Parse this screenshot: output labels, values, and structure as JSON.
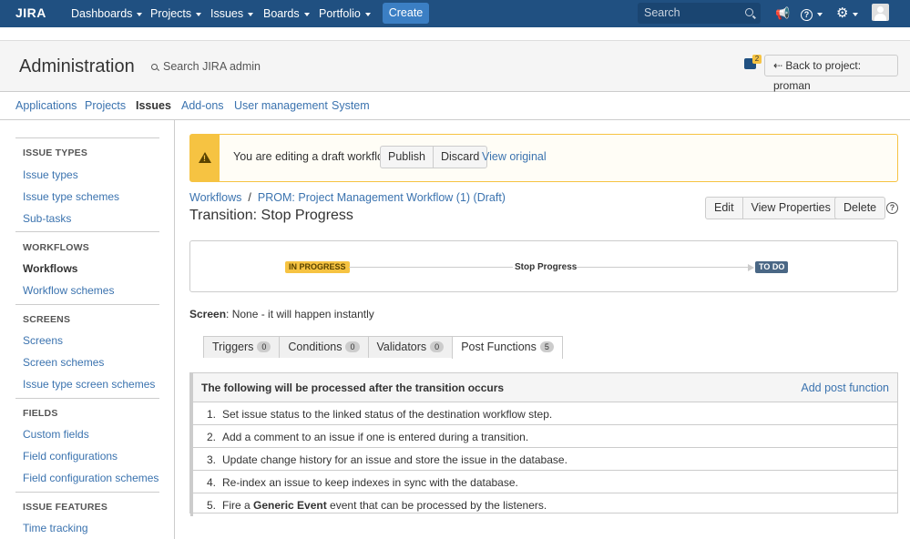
{
  "topnav": {
    "logo": "JIRA",
    "items": [
      "Dashboards",
      "Projects",
      "Issues",
      "Boards",
      "Portfolio"
    ],
    "create": "Create",
    "search_placeholder": "Search"
  },
  "header": {
    "title": "Administration",
    "search": "Search JIRA admin",
    "notif_count": "2",
    "back": "Back to project: proman"
  },
  "admin_tabs": [
    "Applications",
    "Projects",
    "Issues",
    "Add-ons",
    "User management",
    "System"
  ],
  "sidebar": {
    "sections": [
      {
        "heading": "ISSUE TYPES",
        "items": [
          "Issue types",
          "Issue type schemes",
          "Sub-tasks"
        ]
      },
      {
        "heading": "WORKFLOWS",
        "items": [
          "Workflows",
          "Workflow schemes"
        ]
      },
      {
        "heading": "SCREENS",
        "items": [
          "Screens",
          "Screen schemes",
          "Issue type screen schemes"
        ]
      },
      {
        "heading": "FIELDS",
        "items": [
          "Custom fields",
          "Field configurations",
          "Field configuration schemes"
        ]
      },
      {
        "heading": "ISSUE FEATURES",
        "items": [
          "Time tracking"
        ]
      }
    ]
  },
  "warning": {
    "text": "You are editing a draft workflow.",
    "publish": "Publish",
    "discard": "Discard",
    "view_original": "View original"
  },
  "breadcrumb": {
    "root": "Workflows",
    "sep": "/",
    "current": "PROM: Project Management Workflow (1) (Draft)"
  },
  "page_title": "Transition: Stop Progress",
  "toolbar": {
    "edit": "Edit",
    "view_properties": "View Properties",
    "delete": "Delete",
    "help": "?"
  },
  "diagram": {
    "from": "IN PROGRESS",
    "transition": "Stop Progress",
    "to": "TO DO"
  },
  "screen": {
    "label": "Screen",
    "value": ": None - it will happen instantly"
  },
  "tabs": [
    {
      "label": "Triggers",
      "count": "0"
    },
    {
      "label": "Conditions",
      "count": "0"
    },
    {
      "label": "Validators",
      "count": "0"
    },
    {
      "label": "Post Functions",
      "count": "5"
    }
  ],
  "post_functions": {
    "heading": "The following will be processed after the transition occurs",
    "add": "Add post function",
    "items": [
      {
        "num": "1.",
        "text": "Set issue status to the linked status of the destination workflow step."
      },
      {
        "num": "2.",
        "text": "Add a comment to an issue if one is entered during a transition."
      },
      {
        "num": "3.",
        "text": "Update change history for an issue and store the issue in the database."
      },
      {
        "num": "4.",
        "text": "Re-index an issue to keep indexes in sync with the database."
      },
      {
        "num": "5.",
        "pre": "Fire a ",
        "bold": "Generic Event",
        "post": " event that can be processed by the listeners."
      }
    ]
  }
}
